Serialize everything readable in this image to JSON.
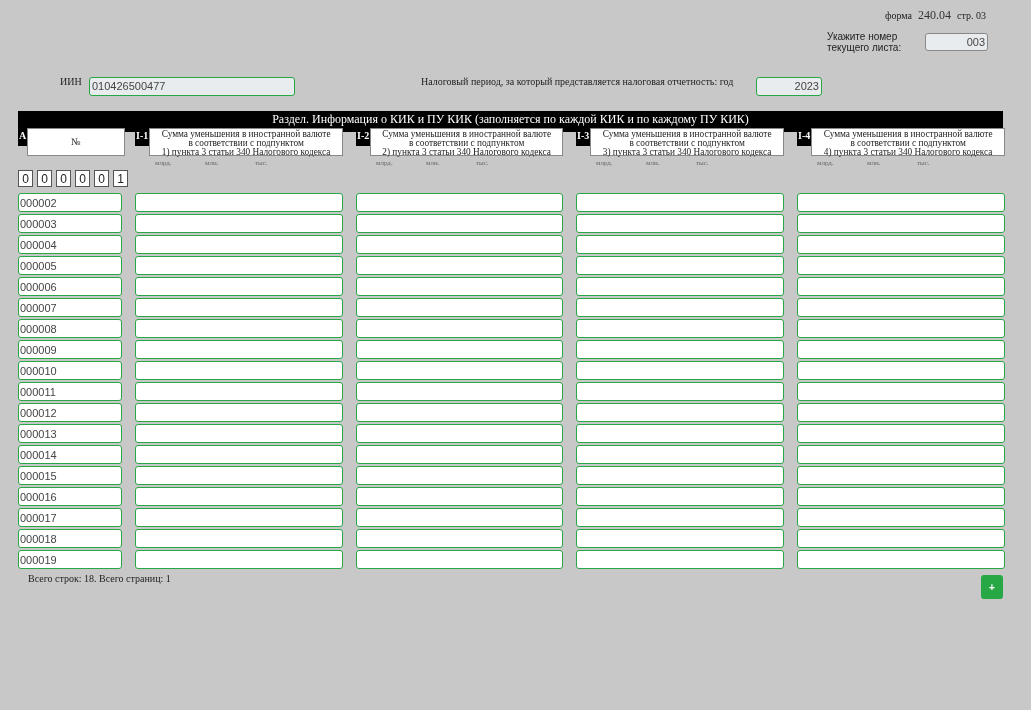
{
  "form_info": {
    "form_label": "форма",
    "form_number": "240.04",
    "page_label": "стр. 03"
  },
  "sheet_number": {
    "label": "Укажите номер текущего листа:",
    "value": "003"
  },
  "iin": {
    "label": "ИИН",
    "value": "010426500477"
  },
  "tax_period": {
    "label": "Налоговый период, за который представляется налоговая отчетность: год",
    "value": "2023"
  },
  "section_title": "Раздел. Информация о КИК и ПУ КИК (заполняется по каждой КИК и по каждому ПУ КИК)",
  "columns": [
    {
      "code": "A",
      "label": "№"
    },
    {
      "code": "I-1",
      "label": "Сумма уменьшения в иностранной валюте\nв соответствии с подпунктом\n1) пункта 3 статьи 340 Налогового кодекса",
      "units": [
        "млрд.",
        "млн.",
        "тыс."
      ]
    },
    {
      "code": "I-2",
      "label": "Сумма уменьшения в иностранной валюте\nв соответствии с подпунктом\n2) пункта 3 статьи 340 Налогового кодекса",
      "units": [
        "млрд.",
        "млн.",
        "тыс."
      ]
    },
    {
      "code": "I-3",
      "label": "Сумма уменьшения в иностранной валюте\nв соответствии с подпунктом\n3) пункта 3 статьи 340 Налогового кодекса",
      "units": [
        "млрд.",
        "млн.",
        "тыс."
      ]
    },
    {
      "code": "I-4",
      "label": "Сумма уменьшения в иностранной валюте\nв соответствии с подпунктом\n4) пункта 3 статьи 340 Налогового кодекса",
      "units": [
        "млрд.",
        "млн.",
        "тыс."
      ]
    }
  ],
  "first_row_digits": [
    "0",
    "0",
    "0",
    "0",
    "0",
    "1"
  ],
  "rows": [
    {
      "number": "000002"
    },
    {
      "number": "000003"
    },
    {
      "number": "000004"
    },
    {
      "number": "000005"
    },
    {
      "number": "000006"
    },
    {
      "number": "000007"
    },
    {
      "number": "000008"
    },
    {
      "number": "000009"
    },
    {
      "number": "000010"
    },
    {
      "number": "000011"
    },
    {
      "number": "000012"
    },
    {
      "number": "000013"
    },
    {
      "number": "000014"
    },
    {
      "number": "000015"
    },
    {
      "number": "000016"
    },
    {
      "number": "000017"
    },
    {
      "number": "000018"
    },
    {
      "number": "000019"
    }
  ],
  "footer": {
    "summary": "Всего строк: 18. Всего страниц: 1",
    "add_button": "+"
  }
}
